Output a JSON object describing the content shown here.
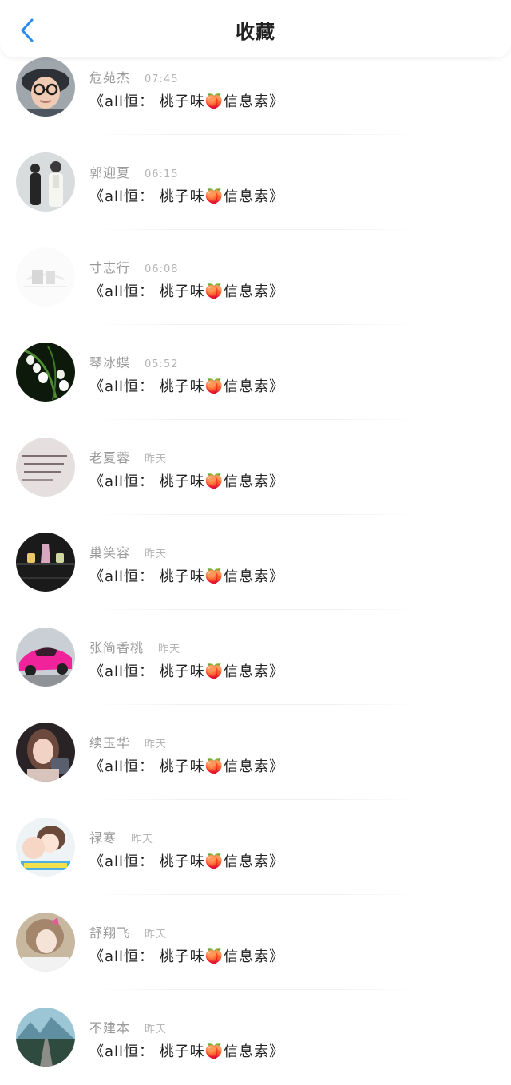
{
  "header": {
    "title": "收藏",
    "back_icon": "chevron-left-icon",
    "accent_color": "#2b8cf0"
  },
  "items": [
    {
      "name": "危苑杰",
      "time": "07:45",
      "message": "《all恒：  桃子味🍑信息素》",
      "avatar": "boy-with-glasses-avatar"
    },
    {
      "name": "郭迎夏",
      "time": "06:15",
      "message": "《all恒：  桃子味🍑信息素》",
      "avatar": "couple-photo-avatar"
    },
    {
      "name": "寸志行",
      "time": "06:08",
      "message": "《all恒：  桃子味🍑信息素》",
      "avatar": "faded-logo-avatar"
    },
    {
      "name": "琴冰蝶",
      "time": "05:52",
      "message": "《all恒：  桃子味🍑信息素》",
      "avatar": "lily-of-valley-avatar"
    },
    {
      "name": "老夏蓉",
      "time": "昨天",
      "message": "《all恒：  桃子味🍑信息素》",
      "avatar": "handwriting-note-avatar"
    },
    {
      "name": "巢笑容",
      "time": "昨天",
      "message": "《all恒：  桃子味🍑信息素》",
      "avatar": "bottles-shelf-avatar"
    },
    {
      "name": "张简香桃",
      "time": "昨天",
      "message": "《all恒：  桃子味🍑信息素》",
      "avatar": "pink-car-avatar"
    },
    {
      "name": "续玉华",
      "time": "昨天",
      "message": "《all恒：  桃子味🍑信息素》",
      "avatar": "girl-portrait-avatar"
    },
    {
      "name": "禄寒",
      "time": "昨天",
      "message": "《all恒：  桃子味🍑信息素》",
      "avatar": "anime-couple-avatar"
    },
    {
      "name": "舒翔飞",
      "time": "昨天",
      "message": "《all恒：  桃子味🍑信息素》",
      "avatar": "girl-with-bow-avatar"
    },
    {
      "name": "不建本",
      "time": "昨天",
      "message": "《all恒：  桃子味🍑信息素》",
      "avatar": "mountain-road-avatar"
    }
  ]
}
